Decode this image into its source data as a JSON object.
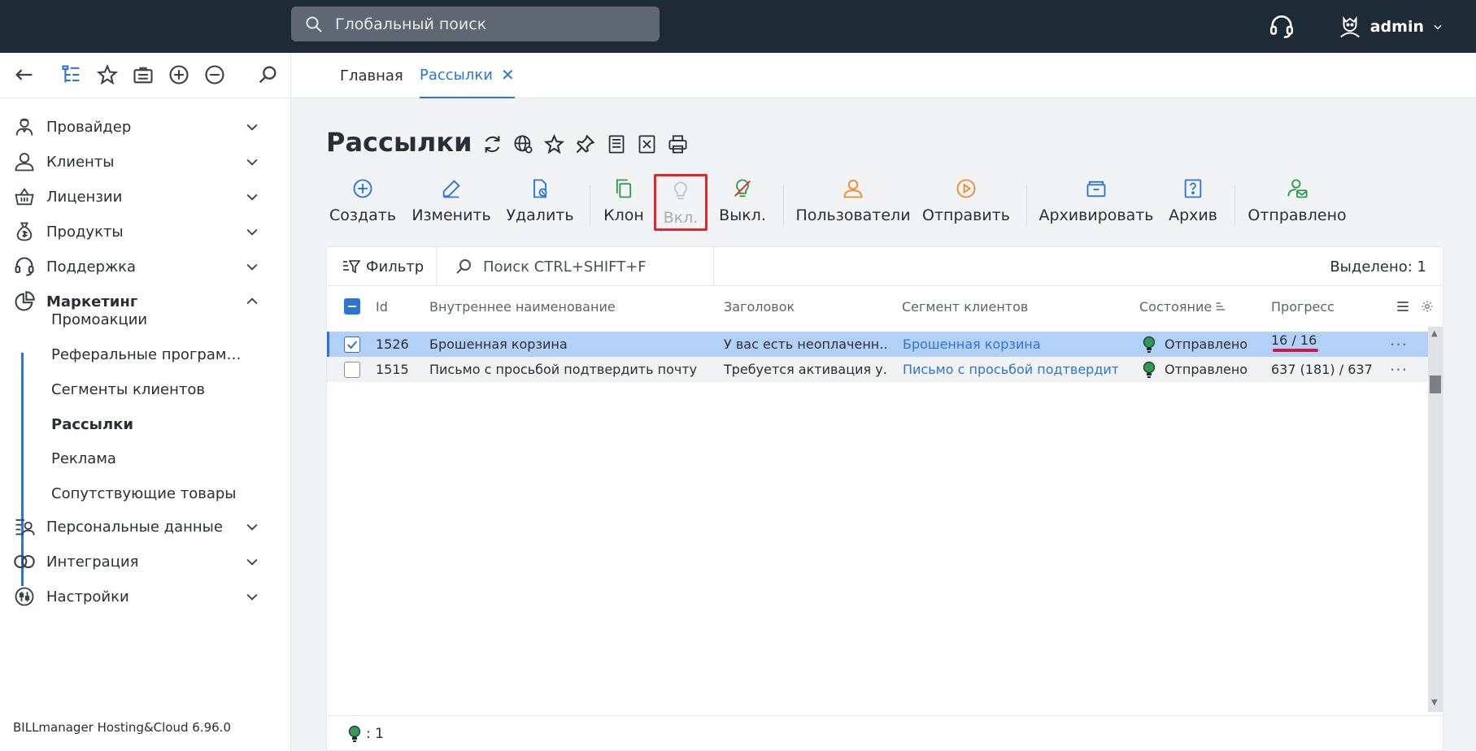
{
  "topbar": {
    "search_placeholder": "Глобальный поиск",
    "user_name": "admin"
  },
  "tabs": [
    {
      "label": "Главная"
    },
    {
      "label": "Рассылки",
      "close": "✕"
    }
  ],
  "sidebar": {
    "items": [
      {
        "label": "Провайдер"
      },
      {
        "label": "Клиенты"
      },
      {
        "label": "Лицензии"
      },
      {
        "label": "Продукты"
      },
      {
        "label": "Поддержка"
      },
      {
        "label": "Маркетинг"
      },
      {
        "label": "Персональные данные"
      },
      {
        "label": "Интеграция"
      },
      {
        "label": "Настройки"
      }
    ],
    "marketing_sub": [
      {
        "label": "Промоакции"
      },
      {
        "label": "Реферальные програм…"
      },
      {
        "label": "Сегменты клиентов"
      },
      {
        "label": "Рассылки"
      },
      {
        "label": "Реклама"
      },
      {
        "label": "Сопутствующие товары"
      }
    ],
    "version": "BILLmanager Hosting&Cloud 6.96.0"
  },
  "page": {
    "title": "Рассылки"
  },
  "actions": [
    {
      "label": "Создать"
    },
    {
      "label": "Изменить"
    },
    {
      "label": "Удалить"
    },
    {
      "label": "Клон"
    },
    {
      "label": "Вкл."
    },
    {
      "label": "Выкл."
    },
    {
      "label": "Пользователи"
    },
    {
      "label": "Отправить"
    },
    {
      "label": "Архивировать"
    },
    {
      "label": "Архив"
    },
    {
      "label": "Отправлено"
    }
  ],
  "list": {
    "filter_label": "Фильтр",
    "search_placeholder": "Поиск CTRL+SHIFT+F",
    "selected": "Выделено: 1",
    "columns": {
      "id": "Id",
      "name": "Внутреннее наименование",
      "subject": "Заголовок",
      "segment": "Сегмент клиентов",
      "state": "Состояние",
      "progress": "Прогресс"
    },
    "rows": [
      {
        "id": "1526",
        "name": "Брошенная корзина",
        "subject": "У вас есть неоплаченн…",
        "segment": "Брошенная корзина",
        "state": "Отправлено",
        "progress": "16 / 16",
        "more": "···"
      },
      {
        "id": "1515",
        "name": "Письмо с просьбой подтвердить почту",
        "subject": "Требуется активация у…",
        "segment": "Письмо с просьбой подтвердит…",
        "state": "Отправлено",
        "progress": "637 (181) / 637",
        "more": "···"
      }
    ],
    "footer_count": ": 1"
  },
  "colors": {
    "accent": "#2b76d2",
    "orange": "#f08c2c",
    "green": "#2e9b4e",
    "highlight": "#e3262c"
  }
}
